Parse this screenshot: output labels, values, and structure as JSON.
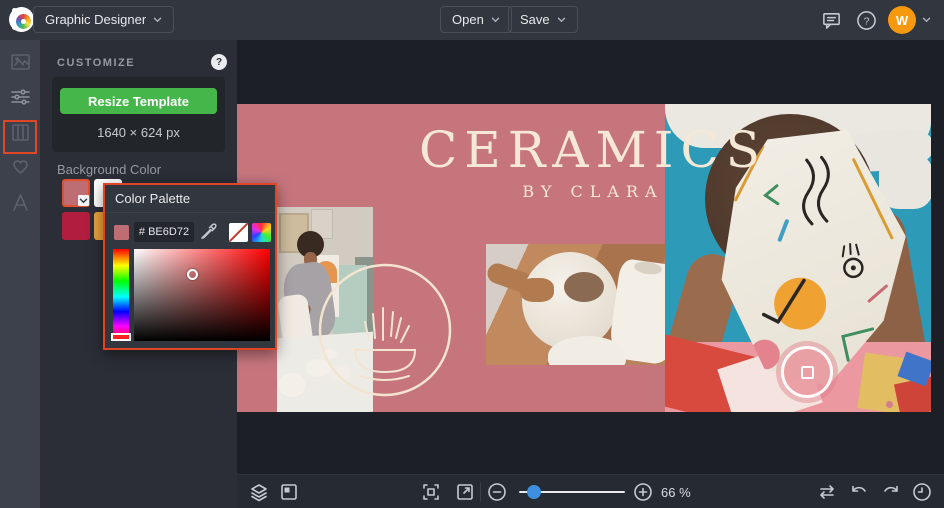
{
  "topbar": {
    "app_menu_label": "Graphic Designer",
    "open_label": "Open",
    "save_label": "Save",
    "help_glyph": "?",
    "avatar_initial": "W"
  },
  "sidebar": {
    "items": [
      {
        "name": "photos",
        "selected": false
      },
      {
        "name": "customize",
        "selected": true
      },
      {
        "name": "layout",
        "selected": false
      },
      {
        "name": "favorites",
        "selected": false
      },
      {
        "name": "text",
        "selected": false
      }
    ]
  },
  "panel": {
    "title": "CUSTOMIZE",
    "help_glyph": "?",
    "resize_button_label": "Resize Template",
    "dimensions_text": "1640 × 624 px",
    "background_color_label": "Background Color",
    "swatches": [
      {
        "name": "selected-pink",
        "color": "#BE6D72"
      },
      {
        "name": "white",
        "color": "#FFFFFF"
      },
      {
        "name": "crimson",
        "color": "#B11D3E"
      },
      {
        "name": "orange",
        "color": "#E9A23B"
      }
    ]
  },
  "color_palette_popup": {
    "title": "Color Palette",
    "hex_value": "# BE6D72",
    "selected_color": "#BE6D72"
  },
  "canvas": {
    "title": "CERAMICS",
    "subtitle": "BY CLARA",
    "background_color": "#C6757D",
    "text_color": "#F5E8D6"
  },
  "bottom_toolbar": {
    "zoom_level": "66 %"
  },
  "colors": {
    "accent_green": "#45B649",
    "annotation_red": "#E04526",
    "slider_blue": "#3E8EE2",
    "avatar_orange": "#F6990F",
    "topbar_bg": "#32363F",
    "panel_bg": "#2B2E37",
    "workspace_bg": "#1C1F26"
  },
  "icons": {
    "befunky-logo": "rainbow b mark",
    "chat-icon": "speech bubble",
    "help-icon": "question mark circle",
    "chevron-down-icon": "v",
    "photos-icon": "picture frame",
    "customize-icon": "sliders",
    "layout-icon": "columns",
    "favorites-icon": "heart",
    "text-icon": "letter A",
    "eyedropper-icon": "color picker dropper",
    "no-color-icon": "white square red slash",
    "rainbow-picker-icon": "rainbow square",
    "layers-icon": "stacked layers",
    "canvas-manager-icon": "square with inset square",
    "fit-screen-icon": "corner brackets",
    "fullscreen-icon": "diagonal arrow box",
    "zoom-out-icon": "minus circle",
    "zoom-in-icon": "plus circle",
    "swap-icon": "loop arrows",
    "undo-icon": "curved arrow left",
    "redo-icon": "curved arrow right",
    "history-icon": "clock"
  }
}
